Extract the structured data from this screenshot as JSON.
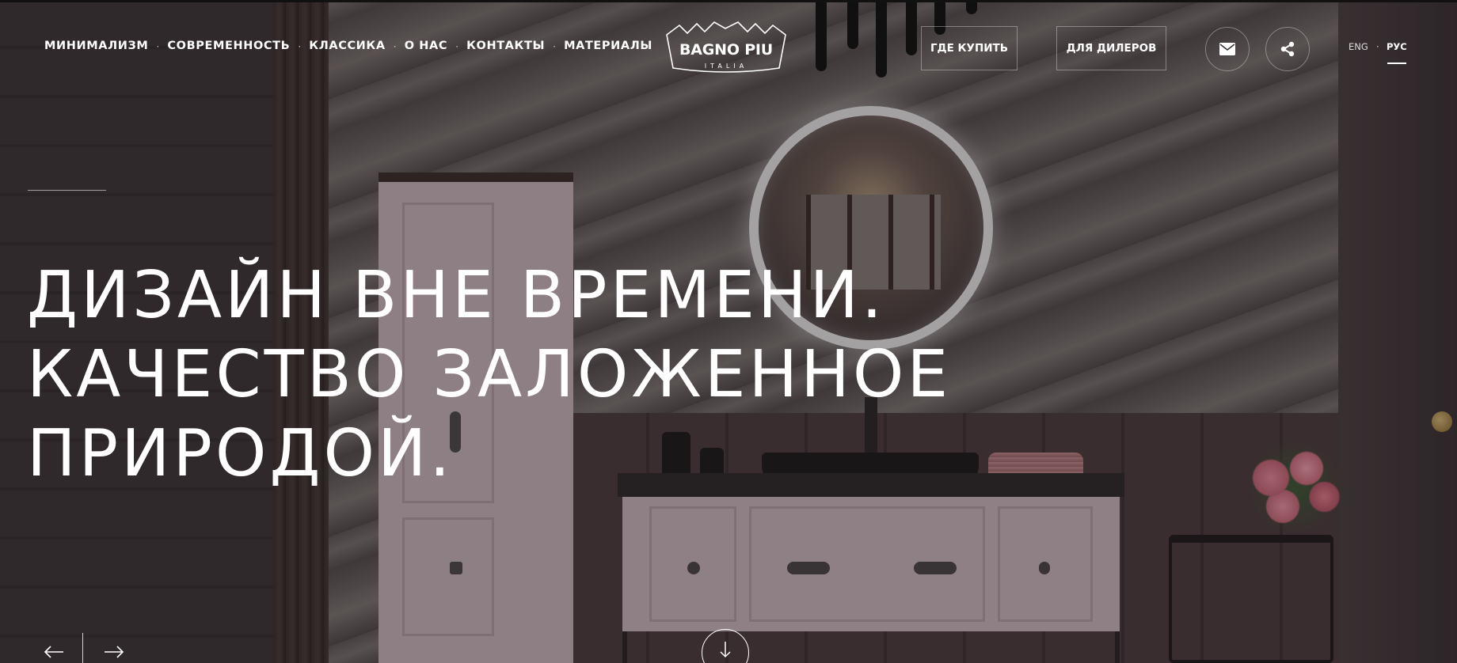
{
  "nav": {
    "items": [
      {
        "label": "МИНИМАЛИЗМ"
      },
      {
        "label": "СОВРЕМЕННОСТЬ"
      },
      {
        "label": "КЛАССИКА"
      },
      {
        "label": "О НАС"
      },
      {
        "label": "КОНТАКТЫ"
      },
      {
        "label": "МАТЕРИАЛЫ"
      }
    ],
    "separator": "·"
  },
  "logo": {
    "main": "BAGNO PIU",
    "sub": "ITALIA"
  },
  "header": {
    "where_to_buy": "ГДЕ КУПИТЬ",
    "for_dealers": "ДЛЯ ДИЛЕРОВ",
    "mail_icon": "mail-icon",
    "share_icon": "share-icon"
  },
  "language": {
    "eng": "ENG",
    "separator": "·",
    "rus": "РУС",
    "active": "РУС"
  },
  "hero": {
    "headline_lines": [
      "ДИЗАЙН ВНЕ ВРЕМЕНИ.",
      "КАЧЕСТВО ЗАЛОЖЕННОЕ",
      "ПРИРОДОЙ."
    ]
  },
  "controls": {
    "prev_icon": "arrow-left-icon",
    "next_icon": "arrow-right-icon",
    "scroll_icon": "arrow-down-icon"
  },
  "colors": {
    "text": "#ffffff",
    "overlay": "#141012",
    "outline": "#ffffff"
  }
}
